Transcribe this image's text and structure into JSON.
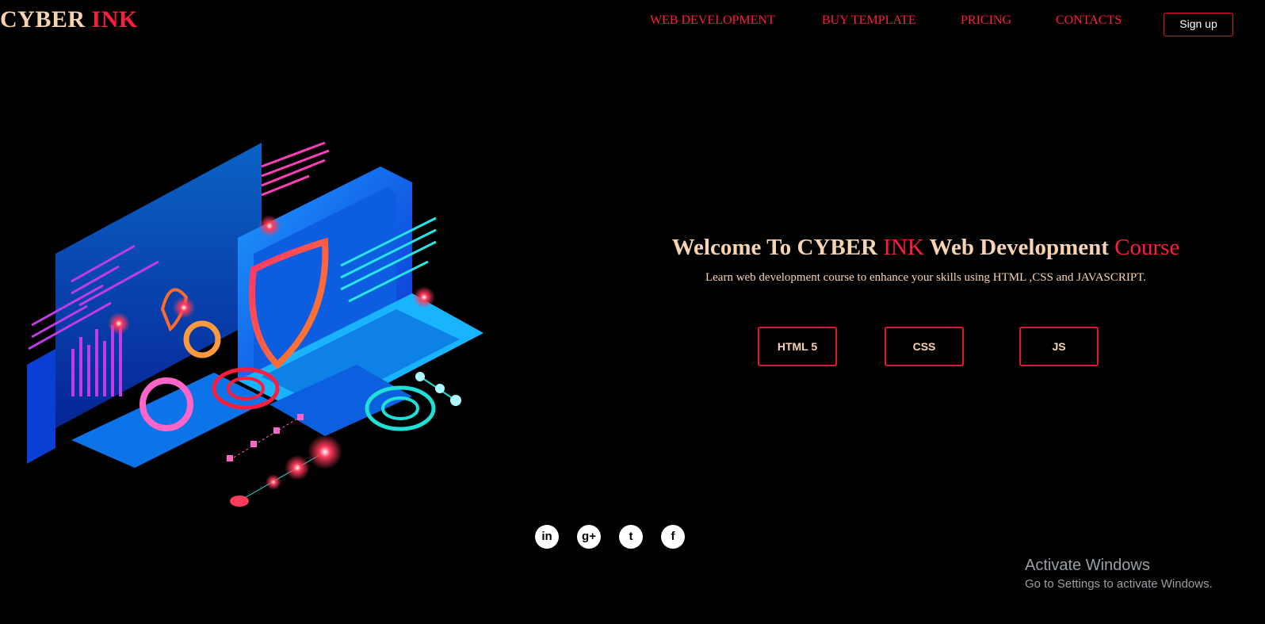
{
  "brand": {
    "part1": "CYBER",
    "part2": "INK"
  },
  "nav": {
    "items": [
      "WEB DEVELOPMENT",
      "BUY TEMPLATE",
      "PRICING",
      "CONTACTS"
    ],
    "signup_label": "Sign up"
  },
  "hero": {
    "title_part1": "Welcome To CYBER ",
    "title_part2": "INK",
    "title_part3": " Web Development ",
    "title_part4": "Course",
    "subtitle": "Learn web development course to enhance your skills using HTML ,CSS and JAVASCRIPT.",
    "buttons": [
      "HTML 5",
      "CSS",
      "JS"
    ]
  },
  "social": {
    "icons": [
      "linkedin-icon",
      "google-plus-icon",
      "twitter-icon",
      "facebook-icon"
    ],
    "glyphs": [
      "in",
      "g+",
      "t",
      "f"
    ]
  },
  "watermark": {
    "title": "Activate Windows",
    "subtitle": "Go to Settings to activate Windows."
  },
  "colors": {
    "accent": "#ff1c3c",
    "cream": "#f6d4b2",
    "background": "#000000"
  }
}
